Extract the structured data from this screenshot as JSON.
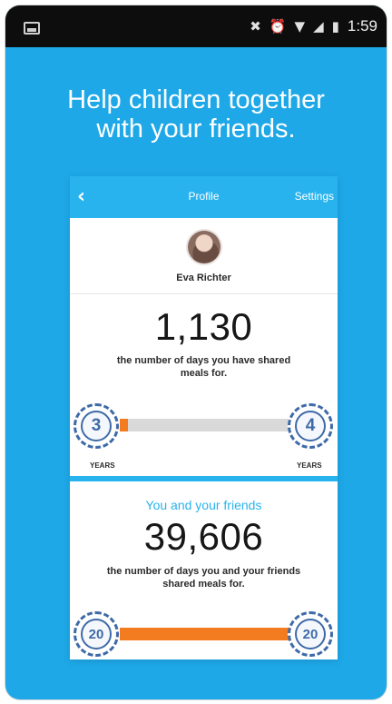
{
  "status_bar": {
    "time": "1:59",
    "icons": [
      "image-icon",
      "mute-icon",
      "alarm-icon",
      "wifi-icon",
      "signal-icon",
      "battery-icon"
    ]
  },
  "headline": {
    "line1": "Help children together",
    "line2": "with your friends."
  },
  "card": {
    "nav": {
      "back_icon": "chevron-left-icon",
      "title": "Profile",
      "settings": "Settings"
    },
    "profile": {
      "name": "Eva Richter"
    },
    "personal": {
      "days": "1,130",
      "caption_line1": "the number of days you have shared",
      "caption_line2": "meals for.",
      "badge_left": "3",
      "badge_right": "4",
      "left_label": "YEARS",
      "right_label": "YEARS",
      "progress_fraction": 0.05
    },
    "friends": {
      "title": "You and your friends",
      "days": "39,606",
      "caption_line1": "the number of days you and your friends",
      "caption_line2": "shared meals for.",
      "badge_left": "20",
      "badge_right": "20",
      "progress_fraction": 1.0
    }
  },
  "colors": {
    "background": "#1ea8e8",
    "nav": "#29b3ee",
    "progress": "#f47c20",
    "badge": "#3f6aa8"
  }
}
